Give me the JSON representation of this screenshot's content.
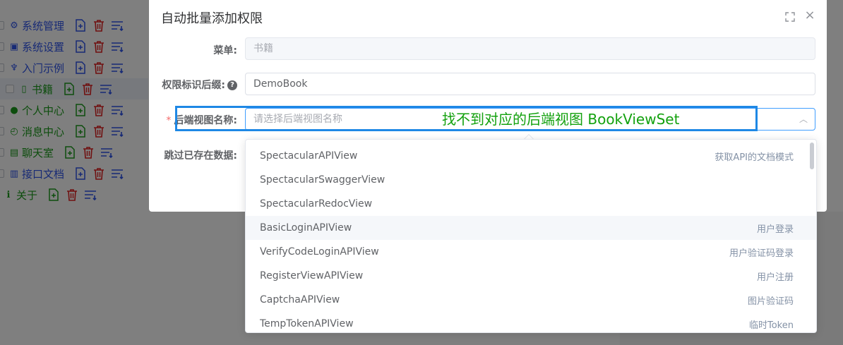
{
  "tree": [
    {
      "icon": "⚙",
      "label": "系统管理",
      "color": "#2f54eb",
      "checkbox": true
    },
    {
      "icon": "▣",
      "label": "系统设置",
      "color": "#2f54eb",
      "checkbox": true
    },
    {
      "icon": "♆",
      "label": "入门示例",
      "color": "#2f54eb",
      "checkbox": true
    },
    {
      "icon": "▯",
      "label": "书籍",
      "color": "#1a9b1a",
      "checkbox": true,
      "active": true
    },
    {
      "icon": "●",
      "label": "个人中心",
      "color": "#1a9b1a",
      "checkbox": true
    },
    {
      "icon": "◴",
      "label": "消息中心",
      "color": "#1a9b1a",
      "checkbox": true
    },
    {
      "icon": "▤",
      "label": "聊天室",
      "color": "#1a9b1a",
      "checkbox": true
    },
    {
      "icon": "▥",
      "label": "接口文档",
      "color": "#2f54eb",
      "checkbox": true
    },
    {
      "icon": "ℹ",
      "label": "关于",
      "color": "#1a9b1a",
      "checkbox": false
    }
  ],
  "dialog": {
    "title": "自动批量添加权限",
    "fields": {
      "menu_label": "菜单:",
      "menu_value": "书籍",
      "suffix_label": "权限标识后缀:",
      "suffix_value": "DemoBook",
      "view_label": "后端视图名称:",
      "view_placeholder": "请选择后端视图名称",
      "skip_label": "跳过已存在数据:"
    }
  },
  "annotation": "找不到对应的后端视图 BookViewSet",
  "dropdown": {
    "options": [
      {
        "name": "SpectacularAPIView",
        "desc": "获取API的文档模式"
      },
      {
        "name": "SpectacularSwaggerView",
        "desc": ""
      },
      {
        "name": "SpectacularRedocView",
        "desc": ""
      },
      {
        "name": "BasicLoginAPIView",
        "desc": "用户登录",
        "hover": true
      },
      {
        "name": "VerifyCodeLoginAPIView",
        "desc": "用户验证码登录"
      },
      {
        "name": "RegisterViewAPIView",
        "desc": "用户注册"
      },
      {
        "name": "CaptchaAPIView",
        "desc": "图片验证码"
      },
      {
        "name": "TempTokenAPIView",
        "desc": "临时Token"
      }
    ]
  },
  "colors": {
    "accent": "#409eff",
    "annotation": "#13a10e",
    "highlight": "#1e88e5",
    "danger": "#f56c6c"
  }
}
